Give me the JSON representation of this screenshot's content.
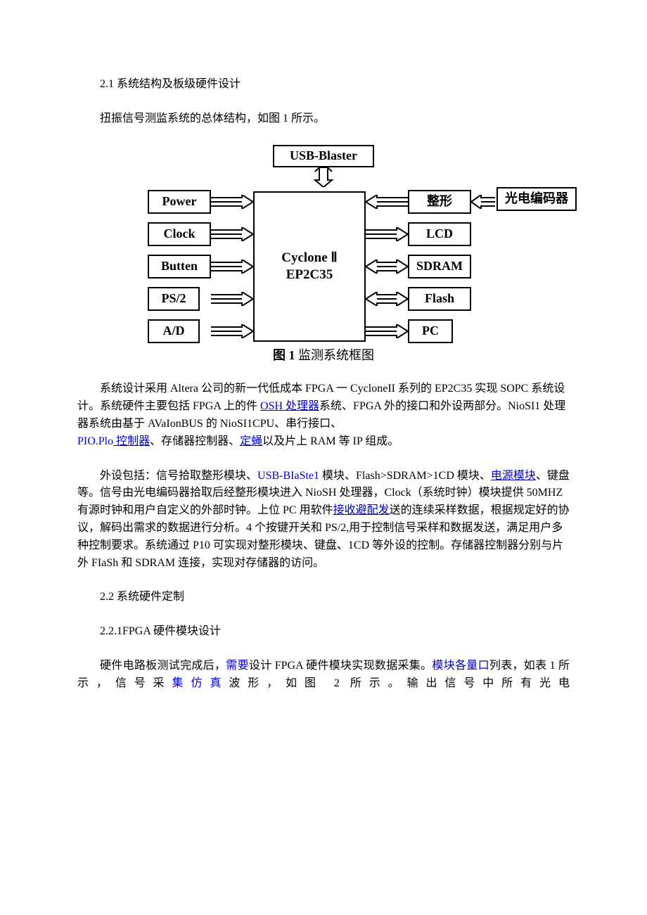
{
  "sections": {
    "s21_title": "2.1 系统结构及板级硬件设计",
    "s21_intro": "扭振信号测监系统的总体结构，如图 1 所示。",
    "s22_title": "2.2 系统硬件定制",
    "s221_title": "2.2.1FPGA 硬件模块设计"
  },
  "diagram": {
    "usb": "USB-Blaster",
    "left": [
      "Power",
      "Clock",
      "Butten",
      "PS/2",
      "A/D"
    ],
    "fpga_line1": "Cyclone Ⅱ",
    "fpga_line2": "EP2C35",
    "right": [
      "整形",
      "LCD",
      "SDRAM",
      "Flash",
      "PC"
    ],
    "far_right": "光电编码器",
    "caption_prefix": "图",
    "caption_num": "1",
    "caption_text": "监测系统框图"
  },
  "para3": {
    "t1": "系统设计采用 Altera 公司的新一代低成本 FPGA 一 CycloneII 系列的 EP2C35 实现 SOPC 系统设计。系统硬件主要包括 FPGA 上的件 ",
    "link1": "OSH 处理器",
    "t2": "系统、FPGA 外的接口和外设两部分。NioSI1 处理器系统由基于 AVaIonBUS 的 NioSI1CPU、串行接口、",
    "link2_a": "PIO.Plo",
    "link2_b": " 控制器",
    "t3": "、存储器控制器、",
    "link3": "定蝇",
    "t4": "以及片上 RAM 等 IP 组成。"
  },
  "para4": {
    "t1": "外设包括：信号拾取整形模块、",
    "blue1": "USB-BIaSte1",
    "t2": " 模块、Flash>SDRAM>1CD 模块、",
    "link1": "电源模块",
    "t3": "、键盘等。信号由光电编码器拾取后经整形模块进入 NioSH 处理器，Clock（系统时钟）模块提供 50MHZ 有源时钟和用户自定义的外部时钟。上位 PC 用软件",
    "link2": "接收避配发",
    "t4": "送的连续采样数据，根据规定好的协议，解码出需求的数据进行分析。4 个按键开关和 PS/2,用于控制信号采样和数据发送，满足用户多种控制要求。系统通过 P10 可实现对整形模块、键盘、1CD 等外设的控制。存储器控制器分别与片外 FIaSh 和 SDRAM 连接，实现对存储器的访问。"
  },
  "para5": {
    "t1": "硬件电路板测试完成后，",
    "blue1": "需要",
    "t2": "设计 FPGA 硬件模块实现数据采集。",
    "blue2": "模块各量口",
    "t3": "列表，如表 1 所示，信号采",
    "blue3": "集仿真",
    "t4": "波形，如图 2 所示。输出信号中所有光电"
  }
}
